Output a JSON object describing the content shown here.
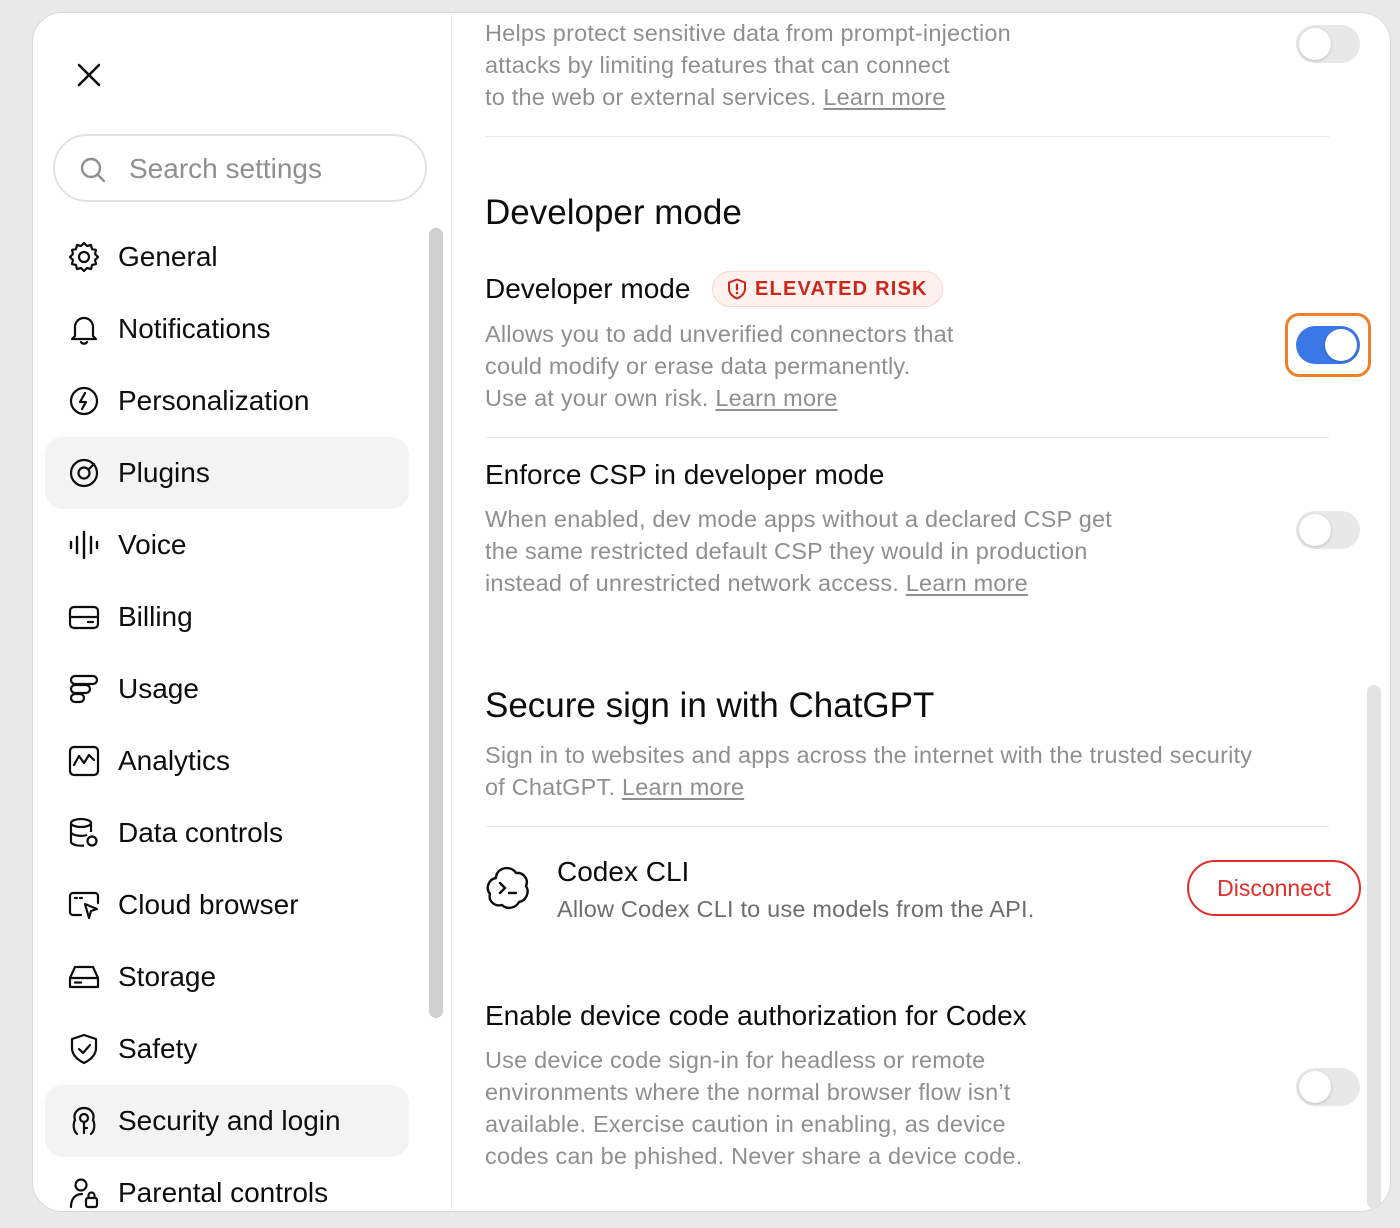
{
  "close": {
    "icon": "close-icon"
  },
  "search": {
    "placeholder": "Search settings",
    "icon": "search-icon"
  },
  "sidebar": {
    "items": [
      {
        "label": "General",
        "icon": "gear-icon"
      },
      {
        "label": "Notifications",
        "icon": "bell-icon"
      },
      {
        "label": "Personalization",
        "icon": "personalization-icon"
      },
      {
        "label": "Plugins",
        "icon": "plugins-icon"
      },
      {
        "label": "Voice",
        "icon": "voice-icon"
      },
      {
        "label": "Billing",
        "icon": "credit-card-icon"
      },
      {
        "label": "Usage",
        "icon": "usage-icon"
      },
      {
        "label": "Analytics",
        "icon": "analytics-icon"
      },
      {
        "label": "Data controls",
        "icon": "database-gear-icon"
      },
      {
        "label": "Cloud browser",
        "icon": "cloud-browser-icon"
      },
      {
        "label": "Storage",
        "icon": "storage-icon"
      },
      {
        "label": "Safety",
        "icon": "shield-check-icon"
      },
      {
        "label": "Security and login",
        "icon": "security-login-icon"
      },
      {
        "label": "Parental controls",
        "icon": "parental-controls-icon"
      }
    ],
    "active": [
      "Plugins",
      "Security and login"
    ]
  },
  "main": {
    "top_desc": {
      "line1": "Helps protect sensitive data from prompt-injection",
      "line2": "attacks by limiting features that can connect",
      "line3": "to the web or external services.",
      "link": "Learn more",
      "toggle_on": false
    },
    "developer_section": {
      "title": "Developer mode",
      "row_title": "Developer mode",
      "badge": "ELEVATED RISK",
      "badge_icon": "shield-alert-icon",
      "desc_line1": "Allows you to add unverified connectors that",
      "desc_line2": "could modify or erase data permanently.",
      "desc_line3": "Use at your own risk.",
      "link": "Learn more",
      "toggle_on": true
    },
    "csp": {
      "title": "Enforce CSP in developer mode",
      "desc_line1": "When enabled, dev mode apps without a declared CSP get",
      "desc_line2": "the same restricted default CSP they would in production",
      "desc_line3": "instead of unrestricted network access.",
      "link": "Learn more",
      "toggle_on": false
    },
    "secure_signin": {
      "title": "Secure sign in with ChatGPT",
      "desc_line1": "Sign in to websites and apps across the internet with the trusted security",
      "desc_line2": "of ChatGPT.",
      "link": "Learn more"
    },
    "codex": {
      "icon": "codex-icon",
      "title": "Codex CLI",
      "desc": "Allow Codex CLI to use models from the API.",
      "button": "Disconnect"
    },
    "device_code": {
      "title": "Enable device code authorization for Codex",
      "desc_line1": "Use device code sign-in for headless or remote",
      "desc_line2": "environments where the normal browser flow isn’t",
      "desc_line3": "available. Exercise caution in enabling, as device",
      "desc_line4": "codes can be phished. Never share a device code.",
      "toggle_on": false
    }
  },
  "colors": {
    "accent": "#3b78e7",
    "focus": "#f07f2a",
    "danger": "#e02e2a",
    "badge_text": "#c9281a",
    "muted_text": "#8f8f8f"
  }
}
